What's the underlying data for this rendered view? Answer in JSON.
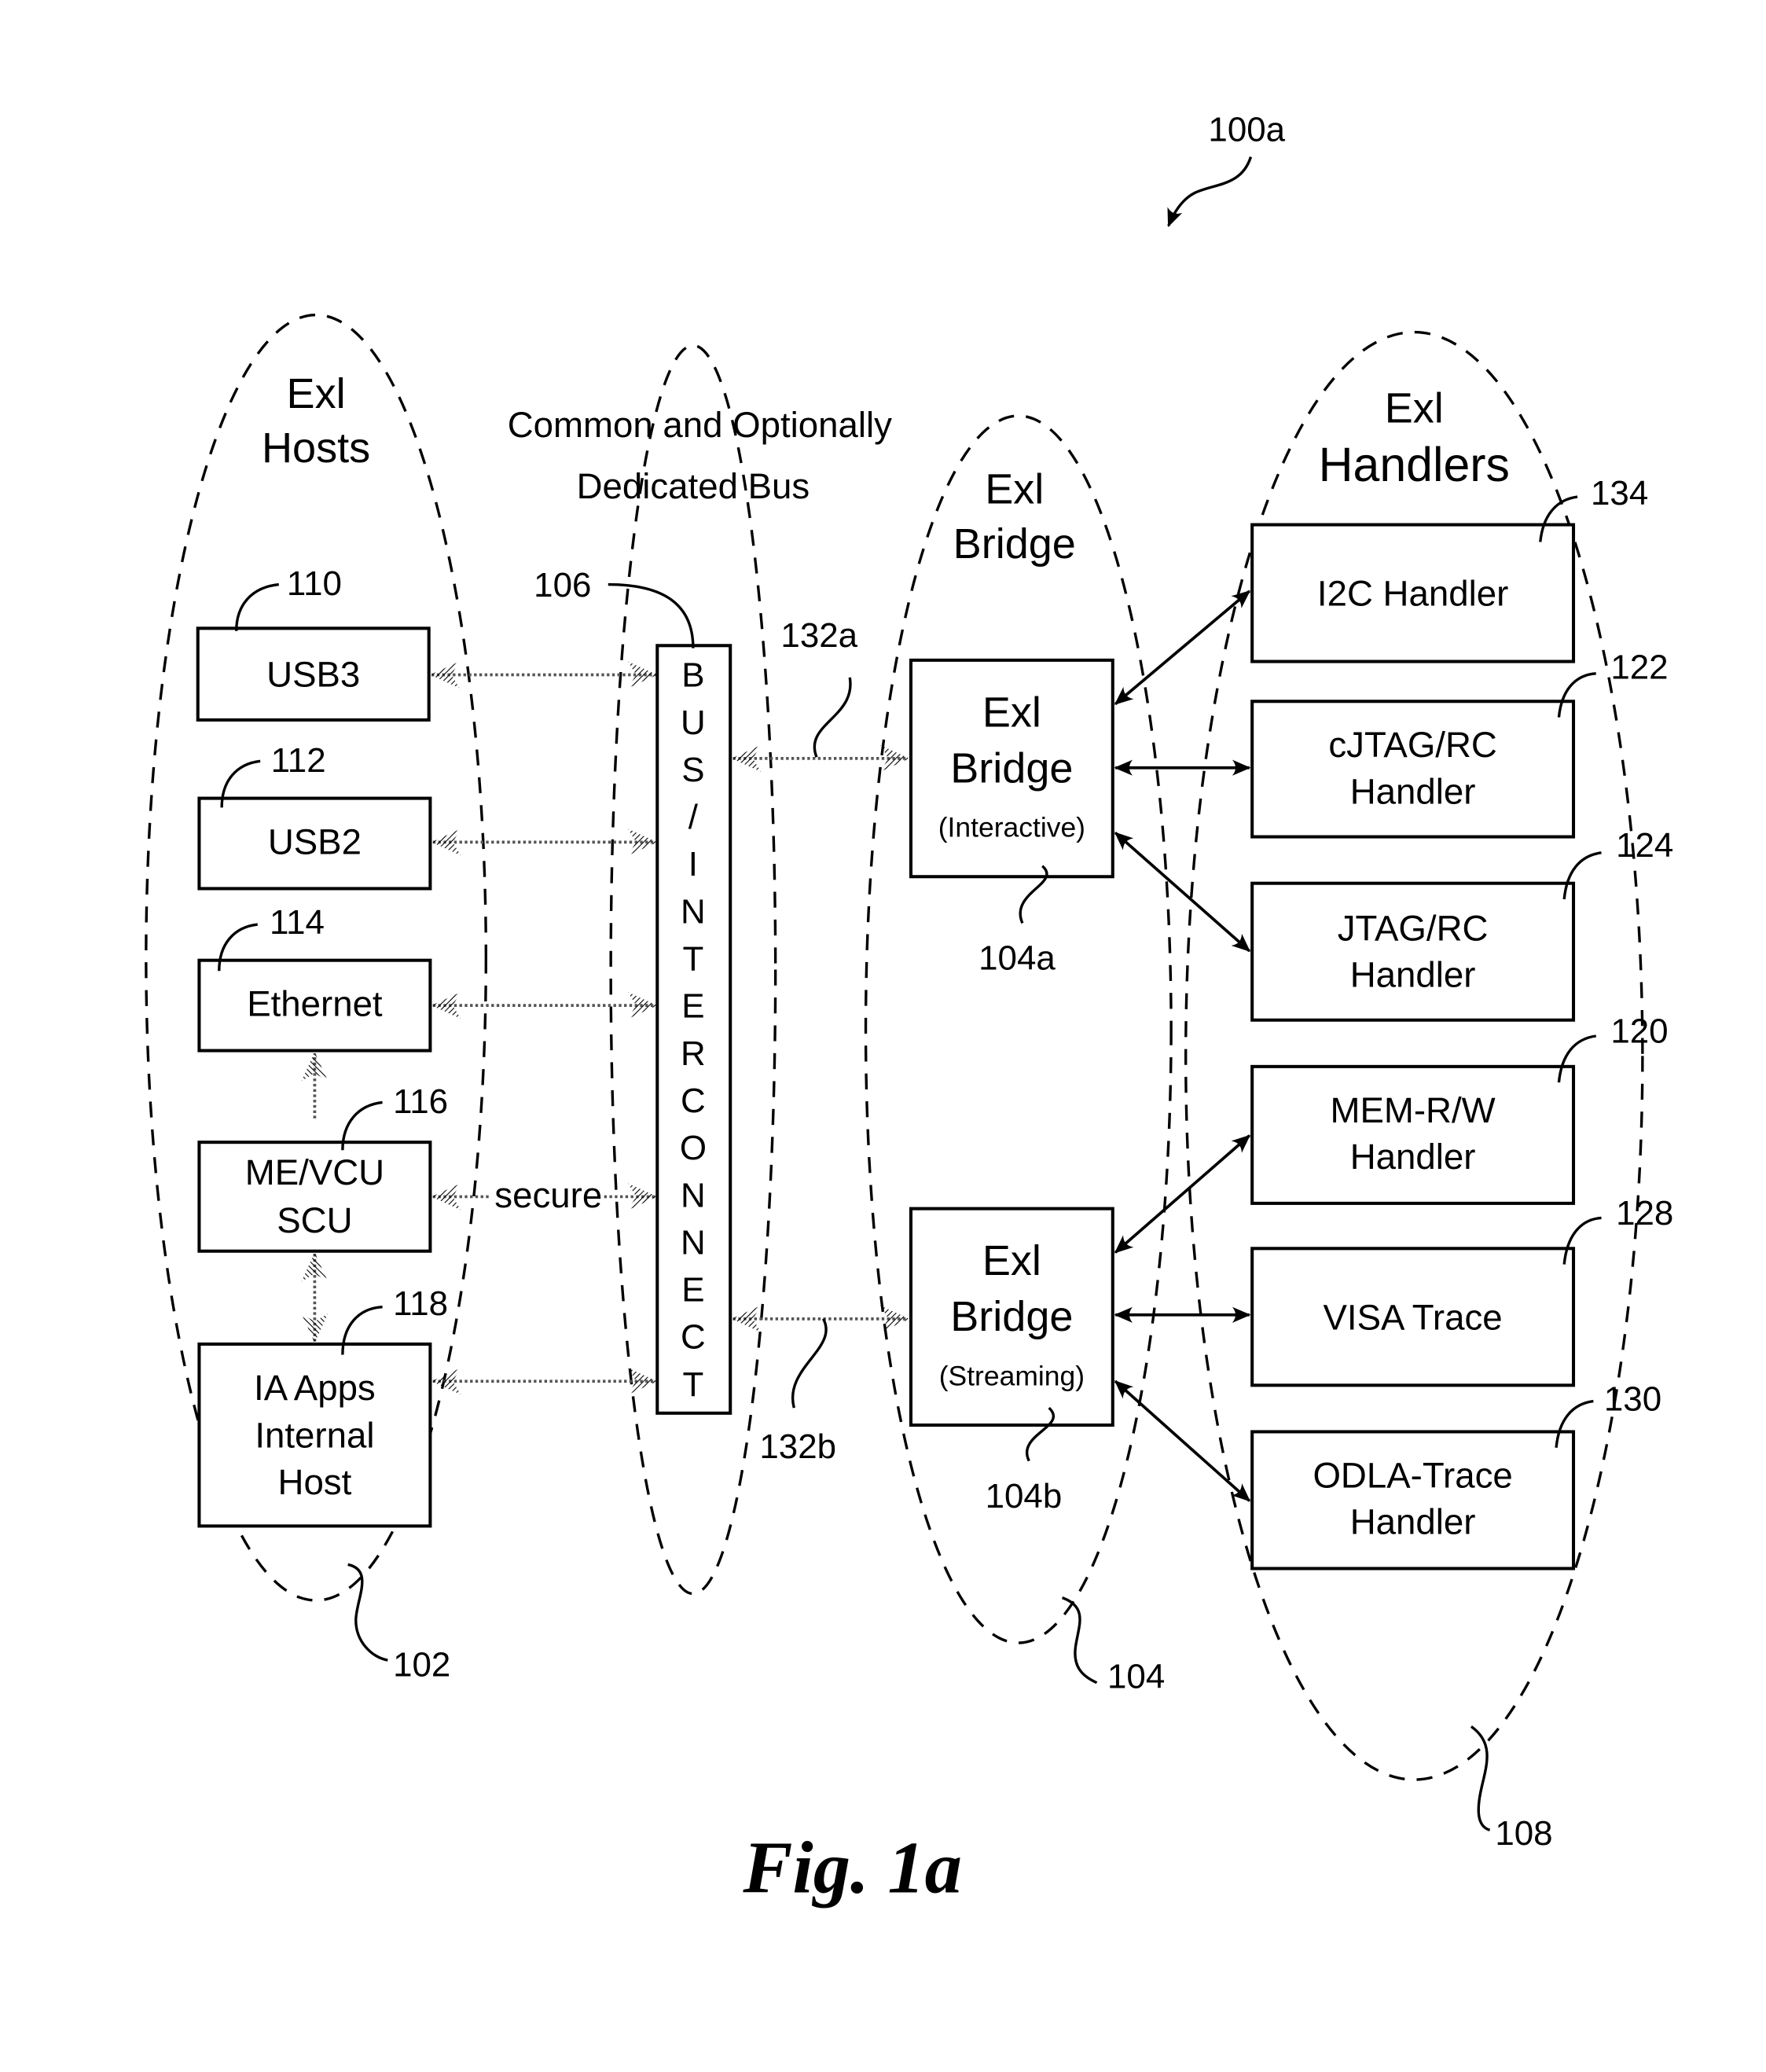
{
  "figure": {
    "ref": "100a",
    "caption": "Fig. 1a"
  },
  "groups": {
    "hosts": {
      "title_line1": "Exl",
      "title_line2": "Hosts",
      "ref": "102"
    },
    "bus": {
      "title_line1": "Common and Optionally",
      "title_line2": "Dedicated Bus",
      "ref": "106",
      "box_letters": [
        "B",
        "U",
        "S",
        "/",
        "I",
        "N",
        "T",
        "E",
        "R",
        "C",
        "O",
        "N",
        "N",
        "E",
        "C",
        "T"
      ]
    },
    "bridge": {
      "title_line1": "Exl",
      "title_line2": "Bridge",
      "ref": "104"
    },
    "handlers": {
      "title_line1": "Exl",
      "title_line2": "Handlers",
      "ref": "108"
    }
  },
  "hosts": [
    {
      "id": "usb3",
      "lines": [
        "USB3"
      ],
      "ref": "110"
    },
    {
      "id": "usb2",
      "lines": [
        "USB2"
      ],
      "ref": "112"
    },
    {
      "id": "ethernet",
      "lines": [
        "Ethernet"
      ],
      "ref": "114"
    },
    {
      "id": "me-vcu-scu",
      "lines": [
        "ME/VCU",
        "SCU"
      ],
      "ref": "116"
    },
    {
      "id": "ia-apps",
      "lines": [
        "IA Apps",
        "Internal",
        "Host"
      ],
      "ref": "118"
    }
  ],
  "bridges": [
    {
      "id": "interactive",
      "lines": [
        "Exl",
        "Bridge"
      ],
      "mode": "(Interactive)",
      "ref": "104a",
      "link_ref": "132a"
    },
    {
      "id": "streaming",
      "lines": [
        "Exl",
        "Bridge"
      ],
      "mode": "(Streaming)",
      "ref": "104b",
      "link_ref": "132b"
    }
  ],
  "handlers": [
    {
      "id": "i2c",
      "lines": [
        "I2C Handler"
      ],
      "ref": "134"
    },
    {
      "id": "cjtag",
      "lines": [
        "cJTAG/RC",
        "Handler"
      ],
      "ref": "122"
    },
    {
      "id": "jtag",
      "lines": [
        "JTAG/RC",
        "Handler"
      ],
      "ref": "124"
    },
    {
      "id": "mem-rw",
      "lines": [
        "MEM-R/W",
        "Handler"
      ],
      "ref": "120"
    },
    {
      "id": "visa",
      "lines": [
        "VISA Trace"
      ],
      "ref": "128"
    },
    {
      "id": "odla",
      "lines": [
        "ODLA-Trace",
        "Handler"
      ],
      "ref": "130"
    }
  ],
  "connections": {
    "secure_label": "secure"
  }
}
